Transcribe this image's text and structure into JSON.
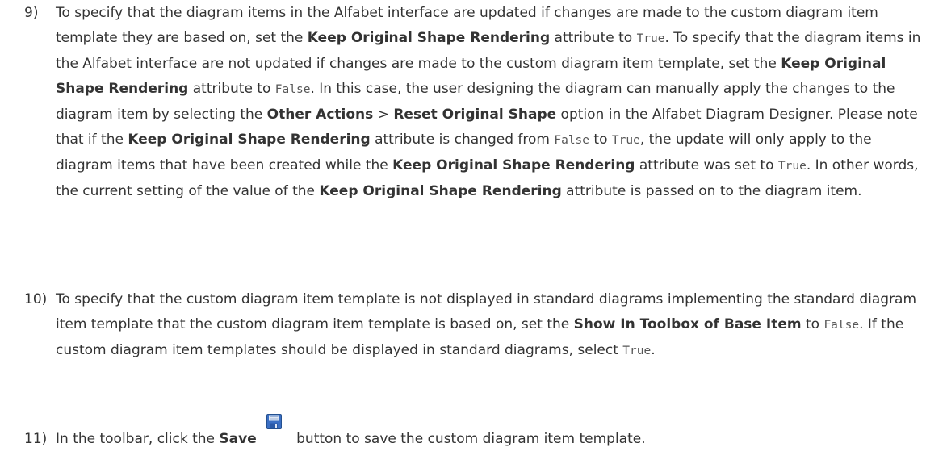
{
  "steps": [
    {
      "number": "9)",
      "t1": "To specify that the diagram items in the Alfabet interface are updated if changes are made to the custom diagram item template they are based on, set the ",
      "b1": "Keep Original Shape Rendering",
      "t2": " attribute to ",
      "c1": "True",
      "t3": ". To specify that the diagram items in the Alfabet interface are not updated if changes are made to the custom diagram item template, set the ",
      "b2": "Keep Original Shape Rendering",
      "t4": " attribute to ",
      "c2": "False",
      "t5": ". In this case, the user designing the diagram can manually apply the changes to the diagram item by selecting the ",
      "b3": "Other Actions",
      "t6": " > ",
      "b4": "Reset Original Shape",
      "t7": " option in the Alfabet Diagram Designer. Please note that if the ",
      "b5": "Keep Original Shape Rendering",
      "t8": " attribute is changed from ",
      "c3": "False",
      "t9": " to ",
      "c4": "True",
      "t10": ", the update will only apply to the diagram items that have been created while the ",
      "b6": "Keep Original Shape Rendering",
      "t11": " attribute was set to ",
      "c5": "True",
      "t12": ". In other words, the current setting of the value of the ",
      "b7": "Keep Original Shape Rendering",
      "t13": " attribute is passed on to the diagram item."
    },
    {
      "number": "10)",
      "t1": "To specify that the custom diagram item template is not displayed in standard diagrams implementing the standard diagram item template that the custom diagram item template is based on, set the ",
      "b1": "Show In Toolbox of Base Item",
      "t2": " to ",
      "c1": "False",
      "t3": ". If the custom diagram item templates should be displayed in standard diagrams, select ",
      "c2": "True",
      "t4": "."
    },
    {
      "number": "11)",
      "t1": "In the toolbar, click the ",
      "b1": "Save",
      "icon": "save-icon",
      "t2": " button to save the custom diagram item template."
    }
  ],
  "colors": {
    "text": "#333333",
    "code": "#555555",
    "icon_blue": "#3a6fc4",
    "icon_label": "#dfe8f5"
  }
}
